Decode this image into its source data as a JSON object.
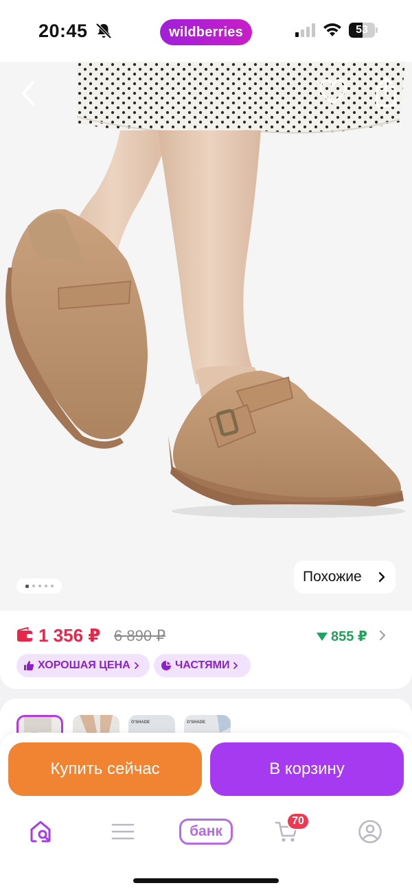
{
  "status_bar": {
    "time": "20:45",
    "app_pill": "wildberries",
    "battery": "53",
    "battery_level": 0.53
  },
  "hero": {
    "similar_label": "Похожие",
    "slide_count": 5,
    "active_slide": 1
  },
  "price": {
    "current": "1 356 ₽",
    "old": "6 890 ₽",
    "discount": "855 ₽",
    "accent_color": "#e5284a",
    "discount_color": "#1fa35a"
  },
  "chips": {
    "good_price": "ХОРОШАЯ ЦЕНА",
    "installments": "ЧАСТЯМИ"
  },
  "thumbnails": {
    "brand_label": "O'SHADE"
  },
  "actions": {
    "buy_now": "Купить сейчас",
    "add_to_cart": "В корзину"
  },
  "tabbar": {
    "bank": "банк",
    "cart_count": "70"
  },
  "colors": {
    "buy": "#f08433",
    "cart": "#a53af0",
    "chip_bg": "#f1e3fb"
  },
  "icons": [
    "bell-off-icon",
    "signal-icon",
    "wifi-icon",
    "battery-icon",
    "back-icon",
    "heart-icon",
    "share-icon",
    "chevron-right-icon",
    "wallet-icon",
    "down-triangle-icon",
    "thumbs-up-icon",
    "pie-icon",
    "home-search-icon",
    "menu-icon",
    "cart-icon",
    "profile-icon"
  ]
}
